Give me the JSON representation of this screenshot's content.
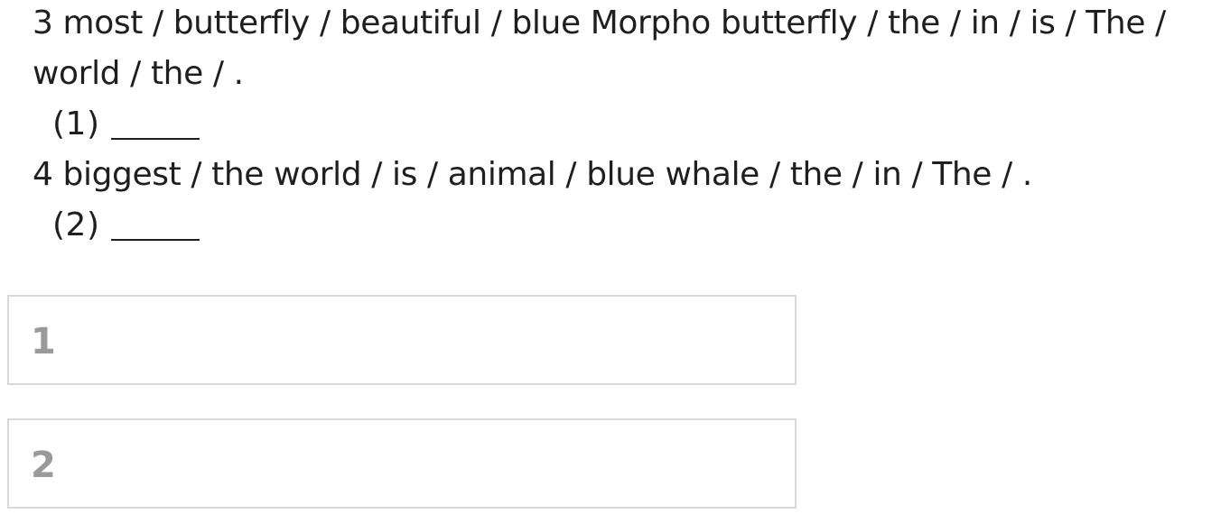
{
  "questions": [
    {
      "line1": "3 most / butterfly / beautiful / blue Morpho butterfly / the / in / is / The /",
      "line2": "world / the / .",
      "blank_label": "(1)"
    },
    {
      "line1": "4 biggest / the world / is / animal / blue whale / the / in / The / .",
      "blank_label": "(2)"
    }
  ],
  "answers": [
    {
      "label": "1",
      "value": ""
    },
    {
      "label": "2",
      "value": ""
    }
  ]
}
